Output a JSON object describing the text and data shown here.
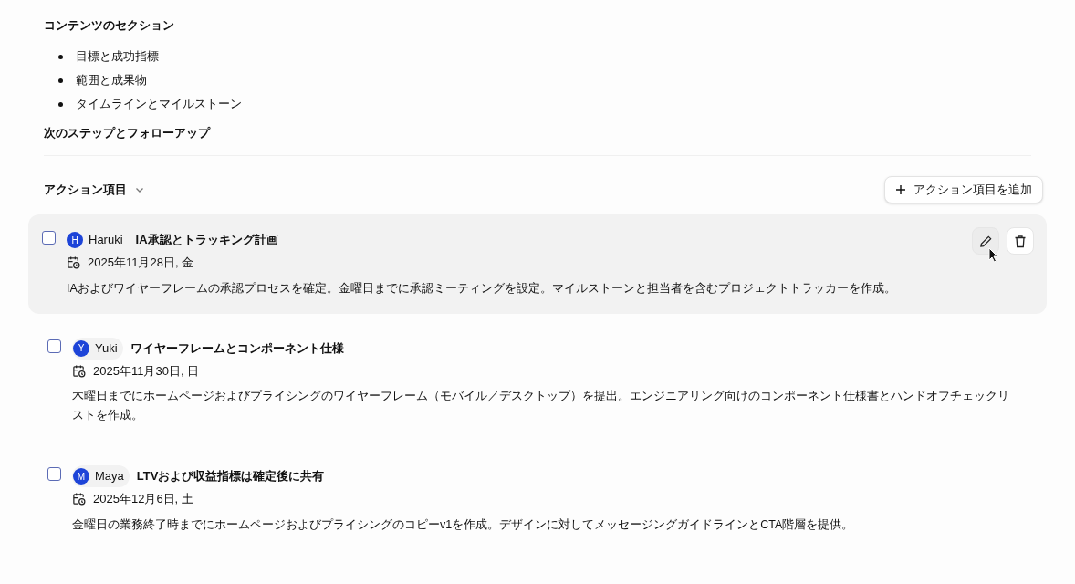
{
  "content_sections": {
    "heading": "コンテンツのセクション",
    "bullets": [
      "目標と成功指標",
      "範囲と成果物",
      "タイムラインとマイルストーン"
    ]
  },
  "next_steps": {
    "heading": "次のステップとフォローアップ"
  },
  "action_items": {
    "heading": "アクション項目",
    "expanded": true,
    "add_button": "アクション項目を追加",
    "items": [
      {
        "checked": false,
        "hovered": true,
        "avatar": "H",
        "assignee": "Haruki",
        "title": "IA承認とトラッキング計画",
        "date": "2025年11月28日, 金",
        "description": "IAおよびワイヤーフレームの承認プロセスを確定。金曜日までに承認ミーティングを設定。マイルストーンと担当者を含むプロジェクトトラッカーを作成。"
      },
      {
        "checked": false,
        "hovered": false,
        "avatar": "Y",
        "assignee": "Yuki",
        "title": "ワイヤーフレームとコンポーネント仕様",
        "date": "2025年11月30日, 日",
        "description": "木曜日までにホームページおよびプライシングのワイヤーフレーム（モバイル／デスクトップ）を提出。エンジニアリング向けのコンポーネント仕様書とハンドオフチェックリストを作成。"
      },
      {
        "checked": false,
        "hovered": false,
        "avatar": "M",
        "assignee": "Maya",
        "title": "LTVおよび収益指標は確定後に共有",
        "date": "2025年12月6日, 土",
        "description": "金曜日の業務終了時までにホームページおよびプライシングのコピーv1を作成。デザインに対してメッセージングガイドラインとCTA階層を提供。"
      }
    ]
  }
}
